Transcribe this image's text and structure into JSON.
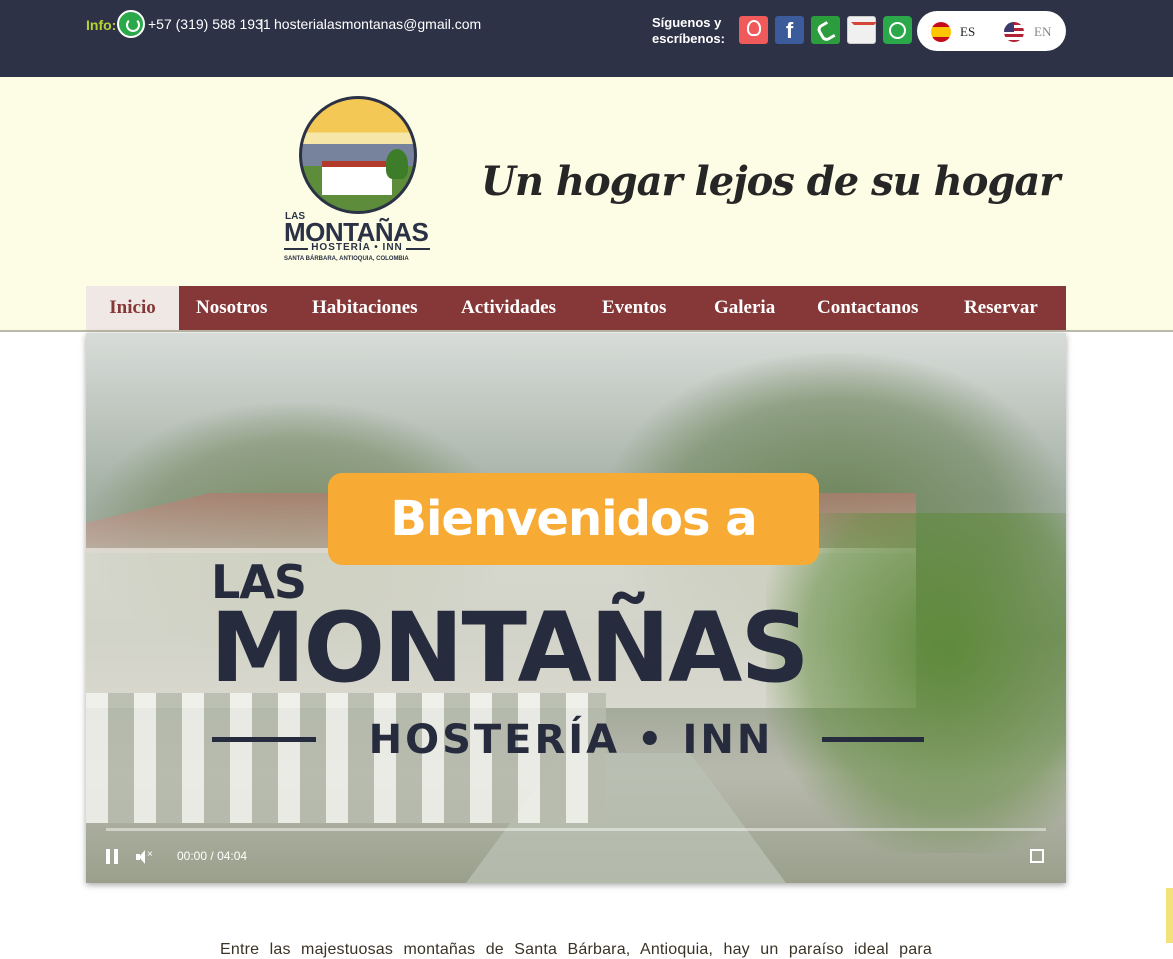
{
  "topbar": {
    "info_label": "Info:",
    "phone": "+57 (319) 588 1931",
    "separator": "|",
    "email": "hosterialasmontanas@gmail.com",
    "follow_label": "Síguenos y escríbenos:",
    "social_icons": [
      "airbnb-icon",
      "facebook-icon",
      "phone-icon",
      "gmail-icon",
      "whatsapp-icon"
    ],
    "airbnb_text": "airbnb",
    "facebook_text": "f",
    "languages": [
      {
        "code": "ES",
        "flag": "spain-flag-icon",
        "active": true
      },
      {
        "code": "EN",
        "flag": "usa-flag-icon",
        "active": false
      }
    ],
    "background": "#2d3246",
    "accent": "#b5d233"
  },
  "header": {
    "logo": {
      "small_text": "LAS",
      "main_text": "MONTAÑAS",
      "sub_text": "HOSTERÍA • INN",
      "location": "SANTA BÁRBARA, ANTIOQUIA, COLOMBIA"
    },
    "slogan": "Un hogar lejos de su hogar",
    "background": "#fdfde6"
  },
  "nav": {
    "items": [
      "Inicio",
      "Nosotros",
      "Habitaciones",
      "Actividades",
      "Eventos",
      "Galeria",
      "Contactanos",
      "Reservar"
    ],
    "active_index": 0,
    "background": "#863838"
  },
  "video": {
    "banner_text": "Bienvenidos a",
    "title_small": "LAS",
    "title_main": "MONTAÑAS",
    "title_sub": "HOSTERÍA • INN",
    "current_time": "00:00",
    "time_separator": "/",
    "duration": "04:04",
    "mute_mark": "×",
    "progress": 0.0,
    "banner_color": "#f8ab34"
  },
  "intro": {
    "text": "Entre las majestuosas montañas de Santa Bárbara, Antioquia, hay un paraíso ideal para"
  }
}
